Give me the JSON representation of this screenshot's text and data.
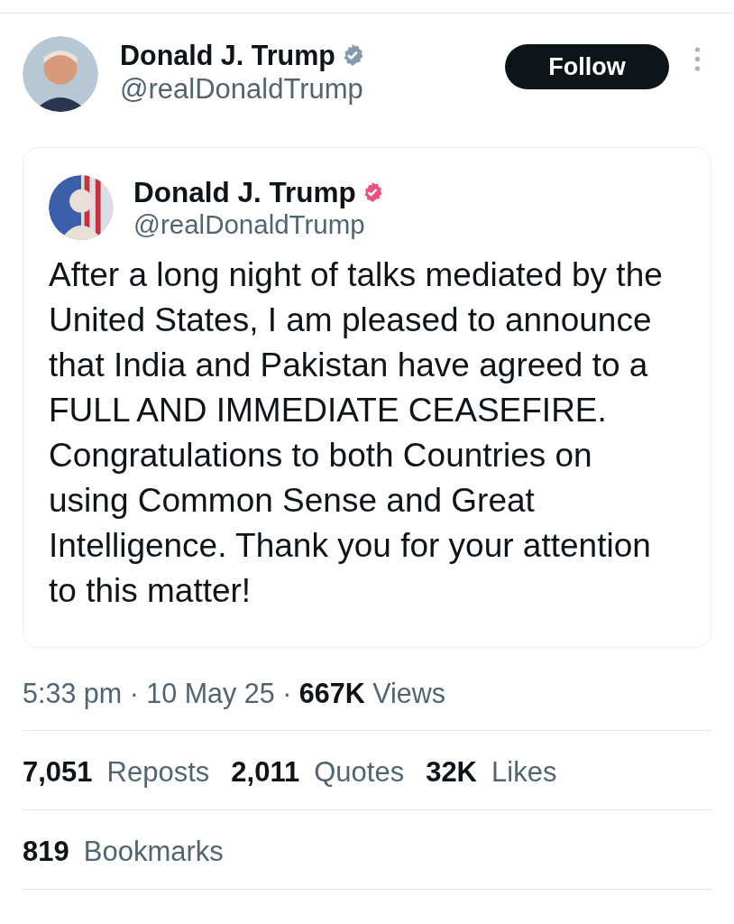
{
  "author": {
    "name": "Donald J. Trump",
    "verified": true,
    "handle": "@realDonaldTrump"
  },
  "follow_button": {
    "label": "Follow"
  },
  "quoted_post": {
    "author": {
      "name": "Donald J. Trump",
      "verified": true,
      "handle": "@realDonaldTrump"
    },
    "text": "After a long night of talks mediated by the United States, I am pleased to announce that India and Pakistan have agreed to a FULL AND IMMEDIATE CEASEFIRE. Congratulations to both Countries on using Common Sense and Great Intelligence. Thank you for your attention to this matter!"
  },
  "meta": "5:33 pm · 10 May 25 · **667K** Views",
  "stats": [
    {
      "count": "7,051",
      "label": "Reposts"
    },
    {
      "count": "2,011",
      "label": "Quotes"
    },
    {
      "count": "32K",
      "label": "Likes"
    }
  ],
  "bookmarks": {
    "count": "819",
    "label": "Bookmarks"
  }
}
